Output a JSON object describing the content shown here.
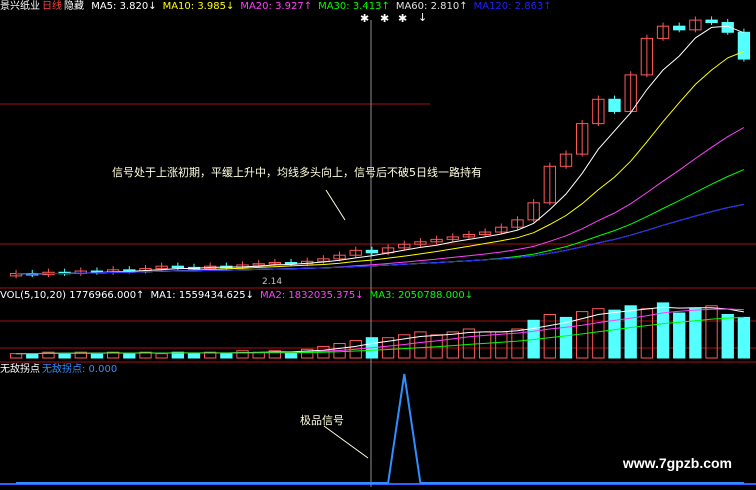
{
  "main_header": {
    "stock": "景兴纸业",
    "period": "日线",
    "mode": "隐藏",
    "ma5": "MA5: 3.820↓",
    "ma10": "MA10: 3.985↓",
    "ma20": "MA20: 3.927↑",
    "ma30": "MA30: 3.413↑",
    "ma60": "MA60: 2.810↑",
    "ma120": "MA120: 2.863↑"
  },
  "main_annotation": "信号处于上涨初期，平缓上升中，均线多头向上，信号后不破5日线一路持有",
  "price_label": "2.14",
  "vol_header": {
    "vol": "VOL(5,10,20) 1776966.000↑",
    "ma1": "MA1: 1559434.625↓",
    "ma2": "MA2: 1832035.375↓",
    "ma3": "MA3: 2050788.000↓"
  },
  "ind_header": {
    "name": "无敌拐点",
    "value": "无敌拐点: 0.000"
  },
  "ind_annotation": "极品信号",
  "watermark": "www.7gpzb.com",
  "colors": {
    "up": "#ff5a5a",
    "down": "#54ffff",
    "ma5": "#ffffff",
    "ma10": "#ffff00",
    "ma20": "#ff40ff",
    "ma30": "#00ff00",
    "ma60": "#e0e0e0",
    "ma120": "#2020ff",
    "signal": "#2f8fff",
    "grid": "#a01010"
  },
  "chart_data": [
    {
      "type": "candlestick",
      "title": "",
      "series_note": "main panel: candles with moving averages",
      "candles": [
        {
          "x": 1,
          "o": 2.1,
          "c": 2.12
        },
        {
          "x": 2,
          "o": 2.12,
          "c": 2.11
        },
        {
          "x": 3,
          "o": 2.11,
          "c": 2.13
        },
        {
          "x": 4,
          "o": 2.13,
          "c": 2.12
        },
        {
          "x": 5,
          "o": 2.12,
          "c": 2.14
        },
        {
          "x": 6,
          "o": 2.14,
          "c": 2.13
        },
        {
          "x": 7,
          "o": 2.13,
          "c": 2.15
        },
        {
          "x": 8,
          "o": 2.15,
          "c": 2.14
        },
        {
          "x": 9,
          "o": 2.14,
          "c": 2.16
        },
        {
          "x": 10,
          "o": 2.16,
          "c": 2.18
        },
        {
          "x": 11,
          "o": 2.18,
          "c": 2.17
        },
        {
          "x": 12,
          "o": 2.17,
          "c": 2.16
        },
        {
          "x": 13,
          "o": 2.16,
          "c": 2.18
        },
        {
          "x": 14,
          "o": 2.18,
          "c": 2.17
        },
        {
          "x": 15,
          "o": 2.17,
          "c": 2.19
        },
        {
          "x": 16,
          "o": 2.19,
          "c": 2.2
        },
        {
          "x": 17,
          "o": 2.2,
          "c": 2.21
        },
        {
          "x": 18,
          "o": 2.21,
          "c": 2.2
        },
        {
          "x": 19,
          "o": 2.2,
          "c": 2.22
        },
        {
          "x": 20,
          "o": 2.22,
          "c": 2.24
        },
        {
          "x": 21,
          "o": 2.24,
          "c": 2.27
        },
        {
          "x": 22,
          "o": 2.27,
          "c": 2.31
        },
        {
          "x": 23,
          "o": 2.31,
          "c": 2.29
        },
        {
          "x": 24,
          "o": 2.29,
          "c": 2.33
        },
        {
          "x": 25,
          "o": 2.33,
          "c": 2.36
        },
        {
          "x": 26,
          "o": 2.36,
          "c": 2.38
        },
        {
          "x": 27,
          "o": 2.38,
          "c": 2.4
        },
        {
          "x": 28,
          "o": 2.4,
          "c": 2.42
        },
        {
          "x": 29,
          "o": 2.42,
          "c": 2.44
        },
        {
          "x": 30,
          "o": 2.44,
          "c": 2.46
        },
        {
          "x": 31,
          "o": 2.46,
          "c": 2.5
        },
        {
          "x": 32,
          "o": 2.5,
          "c": 2.56
        },
        {
          "x": 33,
          "o": 2.56,
          "c": 2.7
        },
        {
          "x": 34,
          "o": 2.7,
          "c": 3.0
        },
        {
          "x": 35,
          "o": 3.0,
          "c": 3.1
        },
        {
          "x": 36,
          "o": 3.1,
          "c": 3.35
        },
        {
          "x": 37,
          "o": 3.35,
          "c": 3.55
        },
        {
          "x": 38,
          "o": 3.55,
          "c": 3.45
        },
        {
          "x": 39,
          "o": 3.45,
          "c": 3.75
        },
        {
          "x": 40,
          "o": 3.75,
          "c": 4.05
        },
        {
          "x": 41,
          "o": 4.05,
          "c": 4.15
        },
        {
          "x": 42,
          "o": 4.15,
          "c": 4.12
        },
        {
          "x": 43,
          "o": 4.12,
          "c": 4.2
        },
        {
          "x": 44,
          "o": 4.2,
          "c": 4.18
        },
        {
          "x": 45,
          "o": 4.18,
          "c": 4.1
        },
        {
          "x": 46,
          "o": 4.1,
          "c": 3.88
        }
      ],
      "ylim": [
        2.05,
        4.25
      ]
    },
    {
      "type": "bar",
      "title": "VOL(5,10,20)",
      "values": [
        3,
        3,
        4,
        3,
        4,
        3,
        4,
        3,
        4,
        3,
        4,
        3,
        4,
        3,
        5,
        4,
        5,
        4,
        6,
        8,
        10,
        12,
        14,
        14,
        16,
        18,
        16,
        18,
        20,
        18,
        18,
        20,
        26,
        30,
        28,
        32,
        34,
        33,
        36,
        34,
        38,
        31,
        34,
        36,
        30,
        28
      ],
      "up": [
        true,
        false,
        true,
        false,
        true,
        false,
        true,
        false,
        true,
        true,
        false,
        false,
        true,
        false,
        true,
        true,
        true,
        false,
        true,
        true,
        true,
        true,
        false,
        true,
        true,
        true,
        true,
        true,
        true,
        true,
        true,
        true,
        false,
        true,
        false,
        true,
        true,
        false,
        false,
        true,
        false,
        false,
        false,
        true,
        false,
        false
      ],
      "ylim": [
        0,
        40
      ]
    },
    {
      "type": "line",
      "title": "无敌拐点",
      "values": [
        0,
        0,
        0,
        0,
        0,
        0,
        0,
        0,
        0,
        0,
        0,
        0,
        0,
        0,
        0,
        0,
        0,
        0,
        0,
        0,
        0,
        0,
        0,
        0,
        1,
        0,
        0,
        0,
        0,
        0,
        0,
        0,
        0,
        0,
        0,
        0,
        0,
        0,
        0,
        0,
        0,
        0,
        0,
        0,
        0,
        0
      ],
      "ylim": [
        0,
        1
      ]
    }
  ]
}
